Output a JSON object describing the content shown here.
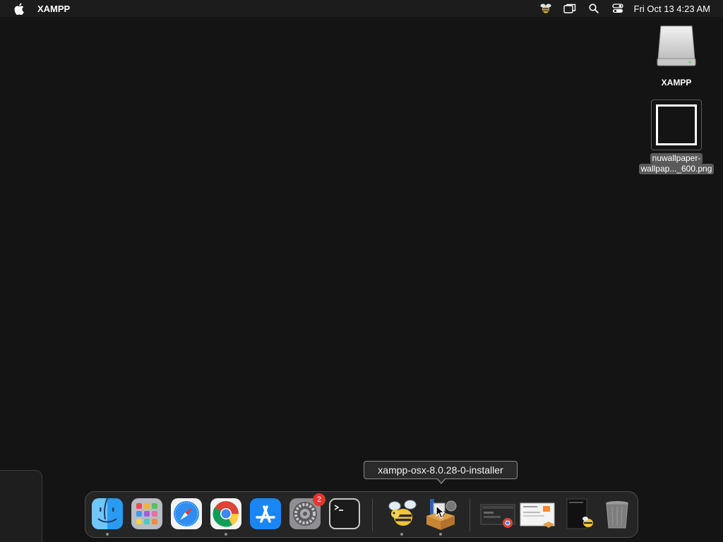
{
  "menubar": {
    "app_name": "XAMPP",
    "clock": "Fri Oct 13  4:23 AM",
    "status_icons": [
      "xampp-bee-icon",
      "screen-mirroring-icon",
      "spotlight-search-icon",
      "control-center-icon"
    ]
  },
  "desktop": {
    "items": [
      {
        "label": "XAMPP",
        "icon": "disk-drive-icon"
      },
      {
        "label_line1": "nuwallpaper-",
        "label_line2": "wallpap..._600.png",
        "icon": "image-file-icon"
      }
    ]
  },
  "tooltip": {
    "text": "xampp-osx-8.0.28-0-installer"
  },
  "dock": {
    "apps": [
      {
        "name": "Finder",
        "icon": "finder-icon",
        "running": true
      },
      {
        "name": "Launchpad",
        "icon": "launchpad-icon",
        "running": false
      },
      {
        "name": "Safari",
        "icon": "safari-icon",
        "running": false
      },
      {
        "name": "Google Chrome",
        "icon": "chrome-icon",
        "running": true
      },
      {
        "name": "App Store",
        "icon": "app-store-icon",
        "running": false
      },
      {
        "name": "System Settings",
        "icon": "system-settings-icon",
        "running": false,
        "badge": "2"
      },
      {
        "name": "Terminal",
        "icon": "terminal-icon",
        "running": false
      },
      {
        "name": "XAMPP Manager",
        "icon": "xampp-bee-icon",
        "running": true
      },
      {
        "name": "xampp-osx-8.0.28-0-installer",
        "icon": "installer-icon",
        "running": true
      }
    ],
    "recents": [
      {
        "icon": "chrome-window-thumbnail-icon"
      },
      {
        "icon": "installer-window-thumbnail-icon"
      },
      {
        "icon": "xampp-window-thumbnail-icon"
      },
      {
        "icon": "trash-icon"
      }
    ]
  },
  "colors": {
    "desktop_bg": "#141414",
    "menubar_bg": "#1c1c1c",
    "badge_red": "#e5352d"
  }
}
